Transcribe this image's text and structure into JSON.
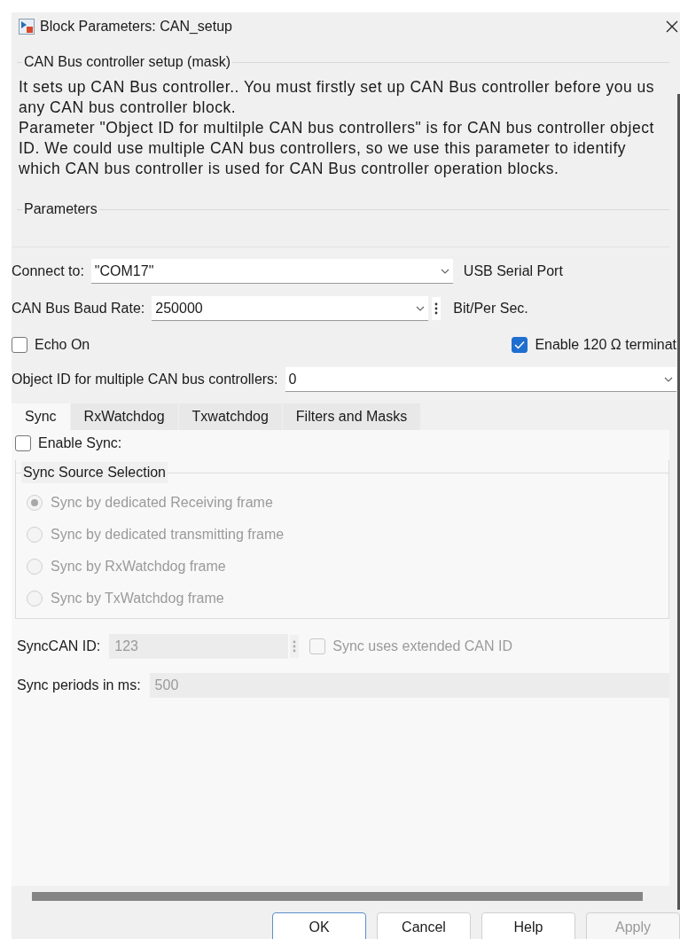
{
  "window": {
    "title": "Block Parameters: CAN_setup"
  },
  "description_group": {
    "title": "CAN Bus controller setup (mask)",
    "lines": [
      "It sets up CAN Bus controller..  You must firstly set up CAN Bus controller before you us",
      "any CAN bus controller block.",
      "Parameter \"Object ID for multilple CAN bus controllers\" is for CAN bus controller object",
      "ID.  We could use multiple CAN bus controllers, so we use this parameter to identify",
      "which CAN bus controller is used for CAN Bus controller operation blocks."
    ]
  },
  "parameters_group": {
    "title": "Parameters"
  },
  "connect": {
    "label": "Connect to:",
    "value": "\"COM17\"",
    "note": "USB Serial Port"
  },
  "baud": {
    "label": "CAN Bus Baud Rate:",
    "value": "250000",
    "note": "Bit/Per Sec."
  },
  "echo": {
    "label": "Echo On",
    "checked": false
  },
  "termination": {
    "label": "Enable 120 Ω terminat",
    "checked": true
  },
  "object_id": {
    "label": "Object ID for multiple CAN bus controllers:",
    "value": "0"
  },
  "tabs": [
    {
      "label": "Sync",
      "selected": true
    },
    {
      "label": "RxWatchdog",
      "selected": false
    },
    {
      "label": "Txwatchdog",
      "selected": false
    },
    {
      "label": "Filters and Masks",
      "selected": false
    }
  ],
  "enable_sync": {
    "label": "Enable Sync:",
    "checked": false
  },
  "sync_source": {
    "title": "Sync Source Selection",
    "options": [
      {
        "label": "Sync by dedicated Receiving frame",
        "selected": true,
        "disabled": true
      },
      {
        "label": "Sync by dedicated transmitting frame",
        "selected": false,
        "disabled": true
      },
      {
        "label": "Sync by RxWatchdog frame",
        "selected": false,
        "disabled": true
      },
      {
        "label": "Sync by TxWatchdog frame",
        "selected": false,
        "disabled": true
      }
    ]
  },
  "sync_can_id": {
    "label": "SyncCAN ID:",
    "value": "123",
    "disabled": true
  },
  "extended_id": {
    "label": "Sync uses extended CAN ID",
    "checked": false,
    "disabled": true
  },
  "sync_period": {
    "label": "Sync periods in ms:",
    "value": "500",
    "disabled": true
  },
  "buttons": [
    {
      "label": "OK",
      "kind": "default",
      "disabled": false
    },
    {
      "label": "Cancel",
      "kind": "normal",
      "disabled": false
    },
    {
      "label": "Help",
      "kind": "normal",
      "disabled": false
    },
    {
      "label": "Apply",
      "kind": "normal",
      "disabled": true
    }
  ]
}
